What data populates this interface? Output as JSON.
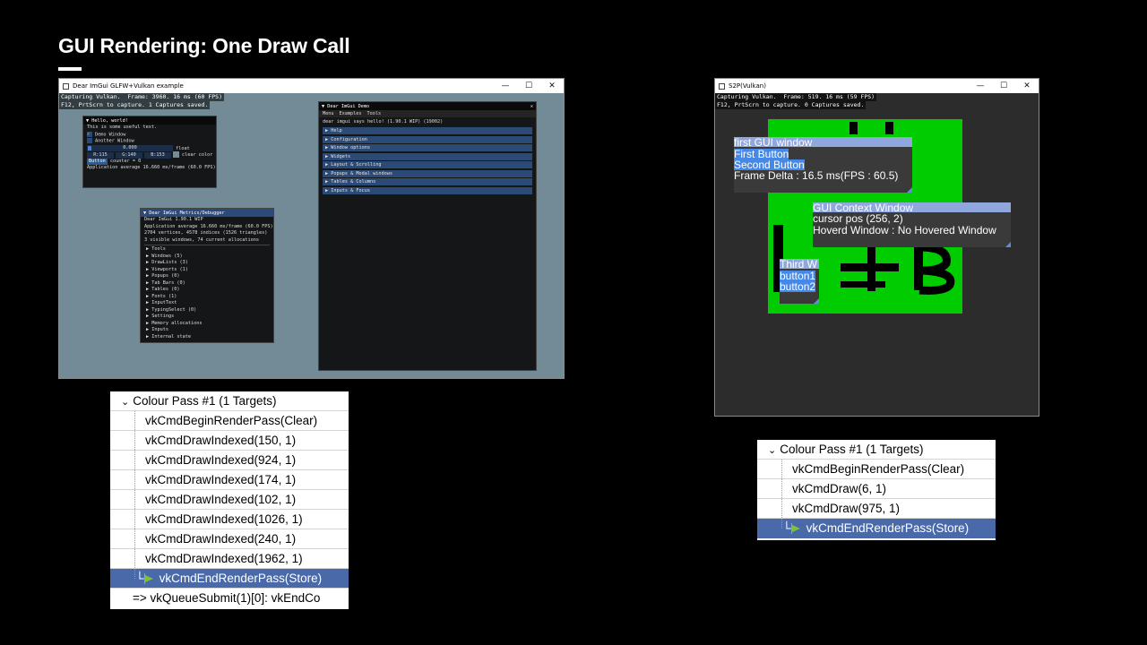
{
  "slide": {
    "title": "GUI Rendering: One Draw Call"
  },
  "left_window": {
    "title": "Dear ImGui GLFW+Vulkan example",
    "overlay": [
      "Capturing Vulkan.  Frame: 3960. 16 ms (60 FPS)",
      "F12, PrtScrn to capture. 1 Captures saved."
    ],
    "hello": {
      "title": "Hello, world!",
      "text": "This is some useful text.",
      "demo_checkbox": "Demo Window",
      "another_checkbox": "Another Window",
      "slider_value": "0.000",
      "slider_label": "float",
      "color_r": "R:115",
      "color_g": "G:140",
      "color_b": "B:153",
      "color_label": "clear color",
      "button": "Button",
      "counter": "counter = 0",
      "fps": "Application average 16.660 ms/frame (60.0 FPS)"
    },
    "metrics": {
      "title": "Dear ImGui Metrics/Debugger",
      "lines": [
        "Dear ImGui 1.90.1 WIP",
        "Application average 16.660 ms/frame (60.0 FPS)",
        "2704 vertices, 4578 indices (1526 triangles)",
        "3 visible windows, 74 current allocations"
      ],
      "tree": [
        "Tools",
        "Windows (5)",
        "DrawLists (3)",
        "Viewports (1)",
        "Popups (0)",
        "Tab Bars (0)",
        "Tables (0)",
        "Fonts (1)",
        "InputText",
        "TypingSelect (0)",
        "Settings",
        "Memory allocations",
        "Inputs",
        "Internal state"
      ]
    },
    "demo": {
      "title": "Dear ImGui Demo",
      "menu": [
        "Menu",
        "Examples",
        "Tools"
      ],
      "says": "dear imgui says hello! (1.90.1 WIP) (19002)",
      "headers": [
        "Help",
        "Configuration",
        "Window options",
        "Widgets",
        "Layout & Scrolling",
        "Popups & Modal windows",
        "Tables & Columns",
        "Inputs & Focus"
      ]
    }
  },
  "left_events": {
    "header": "Colour Pass #1 (1 Targets)",
    "rows": [
      "vkCmdBeginRenderPass(Clear)",
      "vkCmdDrawIndexed(150, 1)",
      "vkCmdDrawIndexed(924, 1)",
      "vkCmdDrawIndexed(174, 1)",
      "vkCmdDrawIndexed(102, 1)",
      "vkCmdDrawIndexed(1026, 1)",
      "vkCmdDrawIndexed(240, 1)",
      "vkCmdDrawIndexed(1962, 1)"
    ],
    "end_row": "vkCmdEndRenderPass(Store)",
    "submit_row": "=>  vkQueueSubmit(1)[0]: vkEndCo"
  },
  "right_window": {
    "title": "S2P(Vulkan)",
    "overlay": [
      "Capturing Vulkan.  Frame: 519. 16 ms (59 FPS)",
      "F12, PrtScrn to capture. 0 Captures saved."
    ],
    "gui1": {
      "title": "first GUI window",
      "btn1": "First Button",
      "btn2": "Second Button",
      "delta": "Frame Delta : 16.5 ms(FPS : 60.5)"
    },
    "ctx": {
      "title": "GUI Context Window",
      "cursor": "cursor pos (256, 2)",
      "hover": "Hoverd Window : No Hovered Window"
    },
    "third": {
      "title": "Third W",
      "b1": "button1",
      "b2": "button2"
    }
  },
  "right_events": {
    "header": "Colour Pass #1 (1 Targets)",
    "rows": [
      "vkCmdBeginRenderPass(Clear)",
      "vkCmdDraw(6, 1)",
      "vkCmdDraw(975, 1)"
    ],
    "end_row": "vkCmdEndRenderPass(Store)"
  },
  "colors": {
    "accent_blue": "#4a69a8",
    "green": "#00cc00",
    "vk_bg": "#728b96"
  }
}
